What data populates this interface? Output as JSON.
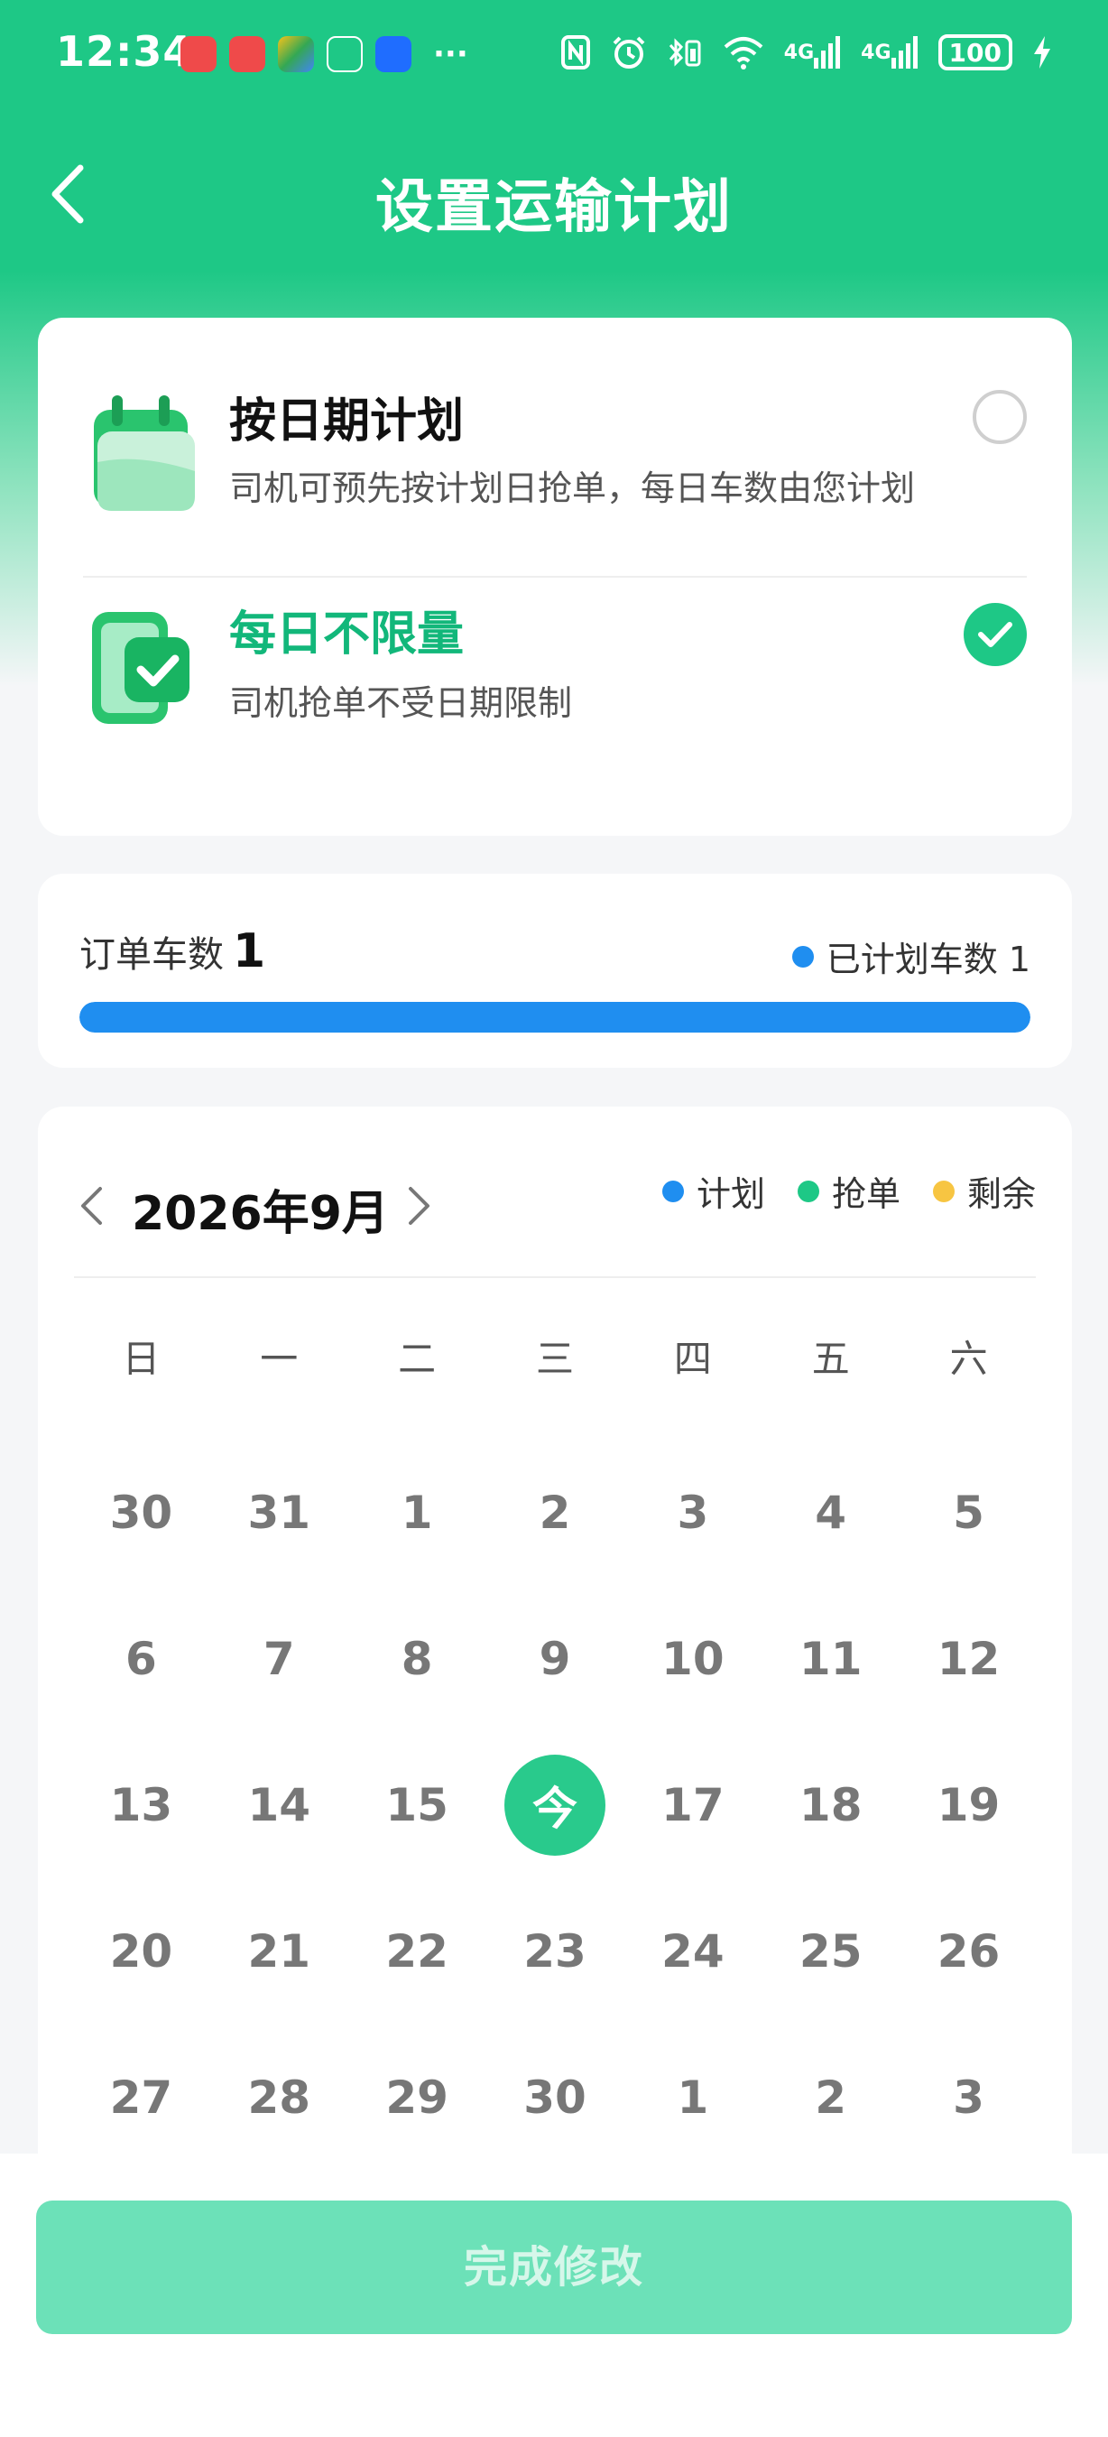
{
  "status_bar": {
    "time": "12:34",
    "more": "···",
    "network_1": "4G",
    "network_2": "4G",
    "battery": "100"
  },
  "nav": {
    "title": "设置运输计划"
  },
  "plan_options": [
    {
      "title": "按日期计划",
      "desc": "司机可预先按计划日抢单，每日车数由您计划",
      "selected": false
    },
    {
      "title": "每日不限量",
      "desc": "司机抢单不受日期限制",
      "selected": true
    }
  ],
  "order": {
    "label": "订单车数",
    "count": "1",
    "planned_label": "已计划车数 1",
    "progress": 1.0
  },
  "calendar": {
    "month_label": "2026年9月",
    "legend": [
      "计划",
      "抢单",
      "剩余"
    ],
    "weekdays": [
      "日",
      "一",
      "二",
      "三",
      "四",
      "五",
      "六"
    ],
    "days": [
      "30",
      "31",
      "1",
      "2",
      "3",
      "4",
      "5",
      "6",
      "7",
      "8",
      "9",
      "10",
      "11",
      "12",
      "13",
      "14",
      "15",
      "今",
      "17",
      "18",
      "19",
      "20",
      "21",
      "22",
      "23",
      "24",
      "25",
      "26",
      "27",
      "28",
      "29",
      "30",
      "1",
      "2",
      "3"
    ],
    "today_index": 17
  },
  "footer": {
    "submit_label": "完成修改"
  },
  "colors": {
    "brand_green": "#1ec886",
    "plan_blue": "#1f8ef0",
    "remaining_yellow": "#f7c542",
    "disabled_button": "#6ce1b8"
  }
}
